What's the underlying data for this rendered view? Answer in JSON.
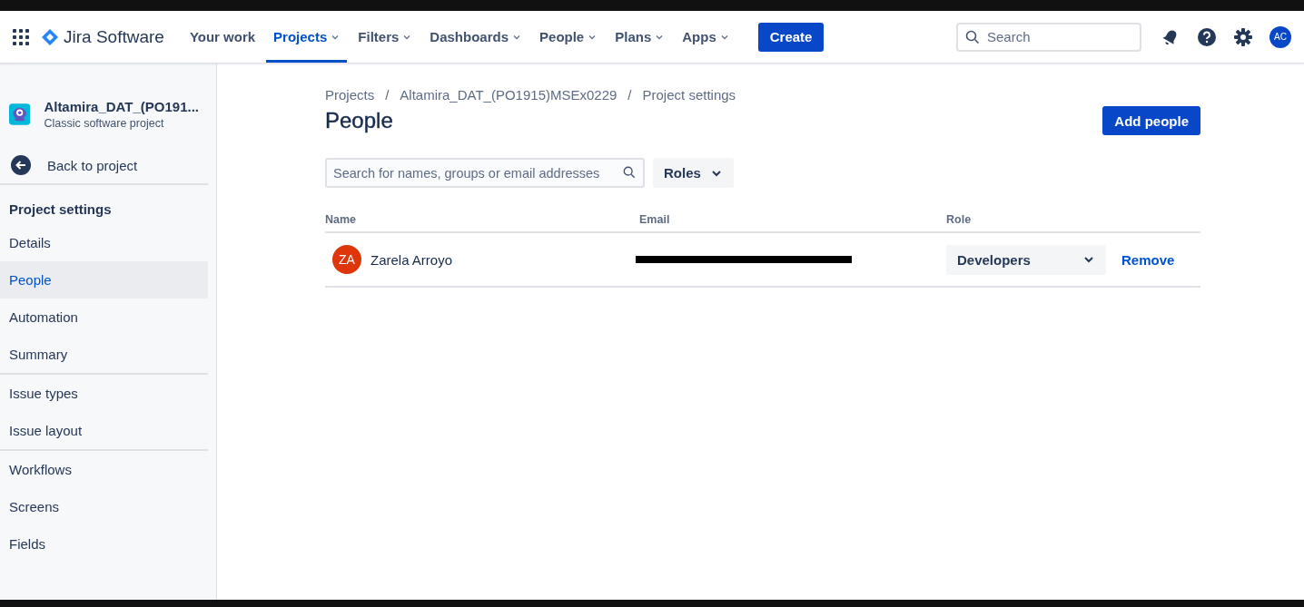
{
  "topnav": {
    "product": "Jira Software",
    "items": [
      {
        "label": "Your work",
        "dropdown": false,
        "selected": false
      },
      {
        "label": "Projects",
        "dropdown": true,
        "selected": true
      },
      {
        "label": "Filters",
        "dropdown": true,
        "selected": false
      },
      {
        "label": "Dashboards",
        "dropdown": true,
        "selected": false
      },
      {
        "label": "People",
        "dropdown": true,
        "selected": false
      },
      {
        "label": "Plans",
        "dropdown": true,
        "selected": false
      },
      {
        "label": "Apps",
        "dropdown": true,
        "selected": false
      }
    ],
    "create": "Create",
    "search": {
      "placeholder": "Search"
    },
    "avatar": "AC"
  },
  "sidebar": {
    "project": {
      "name": "Altamira_DAT_(PO191...",
      "type": "Classic software project"
    },
    "back": "Back to project",
    "heading": "Project settings",
    "groups": [
      [
        {
          "label": "Details",
          "selected": false
        },
        {
          "label": "People",
          "selected": true
        },
        {
          "label": "Automation",
          "selected": false
        },
        {
          "label": "Summary",
          "selected": false
        }
      ],
      [
        {
          "label": "Issue types",
          "selected": false
        },
        {
          "label": "Issue layout",
          "selected": false
        }
      ],
      [
        {
          "label": "Workflows",
          "selected": false
        },
        {
          "label": "Screens",
          "selected": false
        },
        {
          "label": "Fields",
          "selected": false
        }
      ]
    ]
  },
  "breadcrumbs": [
    "Projects",
    "Altamira_DAT_(PO1915)MSEx0229",
    "Project settings"
  ],
  "breadcrumb_separator": "/",
  "title": "People",
  "add_button": "Add people",
  "filter": {
    "placeholder": "Search for names, groups or email addresses",
    "roles": "Roles"
  },
  "table": {
    "columns": [
      "Name",
      "Email",
      "Role"
    ],
    "rows": [
      {
        "initials": "ZA",
        "color": "#de350b",
        "name": "Zarela Arroyo",
        "email_redacted": true,
        "role": "Developers",
        "action": "Remove"
      }
    ]
  }
}
